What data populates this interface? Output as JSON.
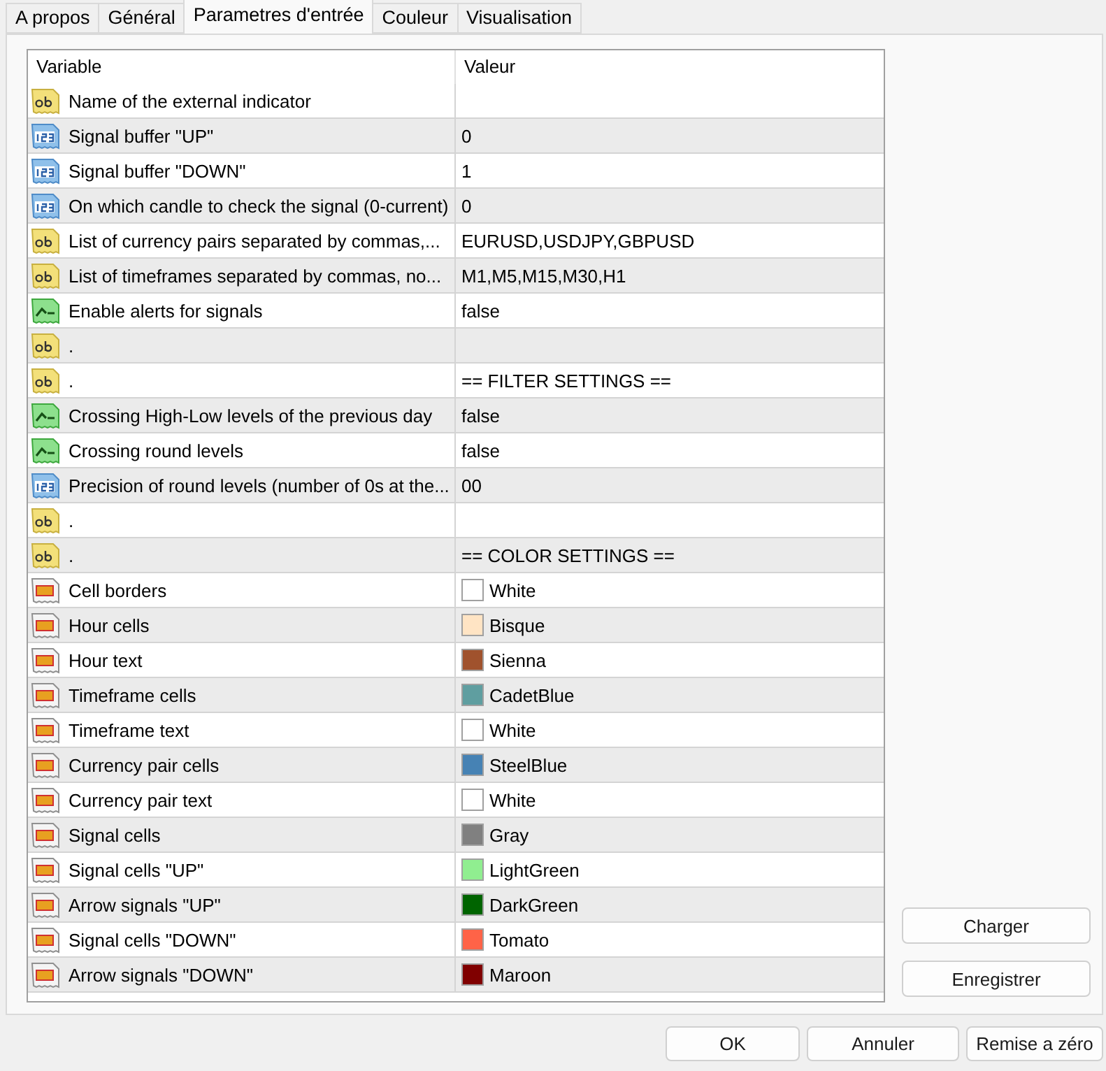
{
  "tabs": [
    {
      "label": "A propos",
      "selected": false
    },
    {
      "label": "Général",
      "selected": false
    },
    {
      "label": "Parametres d'entrée",
      "selected": true
    },
    {
      "label": "Couleur",
      "selected": false
    },
    {
      "label": "Visualisation",
      "selected": false
    }
  ],
  "table": {
    "columns": [
      "Variable",
      "Valeur"
    ],
    "rows": [
      {
        "kind": "string",
        "variable": "Name of the external indicator",
        "value": ""
      },
      {
        "kind": "int",
        "variable": "Signal buffer \"UP\"",
        "value": "0"
      },
      {
        "kind": "int",
        "variable": "Signal buffer \"DOWN\"",
        "value": "1"
      },
      {
        "kind": "int",
        "variable": "On which candle to check the signal (0-current)",
        "value": "0"
      },
      {
        "kind": "string",
        "variable": "List of currency pairs separated by commas,...",
        "value": "EURUSD,USDJPY,GBPUSD"
      },
      {
        "kind": "string",
        "variable": "List of timeframes separated by commas, no...",
        "value": "M1,M5,M15,M30,H1"
      },
      {
        "kind": "bool",
        "variable": "Enable alerts for signals",
        "value": "false"
      },
      {
        "kind": "string",
        "variable": ".",
        "value": ""
      },
      {
        "kind": "string",
        "variable": ".",
        "value": " == FILTER SETTINGS =="
      },
      {
        "kind": "bool",
        "variable": "Crossing High-Low levels of the previous day",
        "value": "false"
      },
      {
        "kind": "bool",
        "variable": "Crossing round levels",
        "value": "false"
      },
      {
        "kind": "int",
        "variable": "Precision of round levels (number of 0s at the...",
        "value": "00"
      },
      {
        "kind": "string",
        "variable": ".",
        "value": ""
      },
      {
        "kind": "string",
        "variable": ".",
        "value": "== COLOR SETTINGS =="
      },
      {
        "kind": "color",
        "variable": "Cell borders",
        "value": "White",
        "color": "#ffffff"
      },
      {
        "kind": "color",
        "variable": "Hour cells",
        "value": "Bisque",
        "color": "#ffe4c4"
      },
      {
        "kind": "color",
        "variable": "Hour text",
        "value": "Sienna",
        "color": "#a0522d"
      },
      {
        "kind": "color",
        "variable": "Timeframe cells",
        "value": "CadetBlue",
        "color": "#5f9ea0"
      },
      {
        "kind": "color",
        "variable": "Timeframe text",
        "value": "White",
        "color": "#ffffff"
      },
      {
        "kind": "color",
        "variable": "Currency pair cells",
        "value": "SteelBlue",
        "color": "#4682b4"
      },
      {
        "kind": "color",
        "variable": "Currency pair text",
        "value": "White",
        "color": "#ffffff"
      },
      {
        "kind": "color",
        "variable": "Signal cells",
        "value": "Gray",
        "color": "#808080"
      },
      {
        "kind": "color",
        "variable": "Signal cells \"UP\"",
        "value": "LightGreen",
        "color": "#90ee90"
      },
      {
        "kind": "color",
        "variable": "Arrow signals \"UP\"",
        "value": "DarkGreen",
        "color": "#006400"
      },
      {
        "kind": "color",
        "variable": "Signal cells \"DOWN\"",
        "value": "Tomato",
        "color": "#ff6347"
      },
      {
        "kind": "color",
        "variable": "Arrow signals \"DOWN\"",
        "value": "Maroon",
        "color": "#800000"
      }
    ]
  },
  "side_buttons": [
    "Charger",
    "Enregistrer"
  ],
  "footer_buttons": [
    "OK",
    "Annuler",
    "Remise a zéro"
  ]
}
